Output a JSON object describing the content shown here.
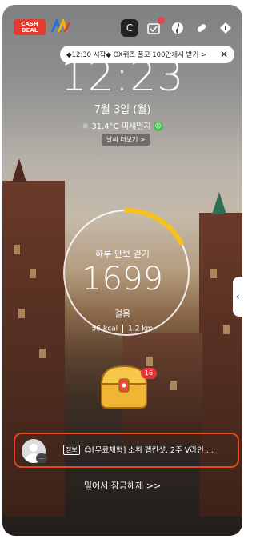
{
  "top_bar": {
    "logo_line1": "CASH",
    "logo_line2": "DEAL",
    "icons": [
      "cashwalk-c-icon",
      "calendar-icon",
      "swirl-icon",
      "pill-icon",
      "info-gift-icon"
    ],
    "calendar_badge": "N"
  },
  "notification": {
    "text": "◆12:30 시작◆ OX퀴즈 풀고 100만캐시 받기 >",
    "close_icon": "close-icon"
  },
  "clock": {
    "time": "12:23"
  },
  "date": {
    "text": "7월 3일 (월)"
  },
  "weather": {
    "temp": "31.4°C",
    "dust_label": "미세먼지",
    "more_button": "날씨 더보기 >"
  },
  "pedometer": {
    "title": "하루 만보 걷기",
    "steps": "1699",
    "unit": "걸음",
    "kcal": "56 kcal",
    "distance": "1.2 km",
    "progress_fraction": 0.17
  },
  "chest": {
    "badge": "16"
  },
  "news": {
    "tag": "정보",
    "text": "😊[무료체험] 소휘 펩킨샷, 2주 V라인 ..."
  },
  "unlock": {
    "text": "밀어서 잠금해제 >>"
  },
  "colors": {
    "ring_accent": "#f6c21b",
    "news_border": "#e04a1c",
    "logo_red": "#e23b2f"
  }
}
